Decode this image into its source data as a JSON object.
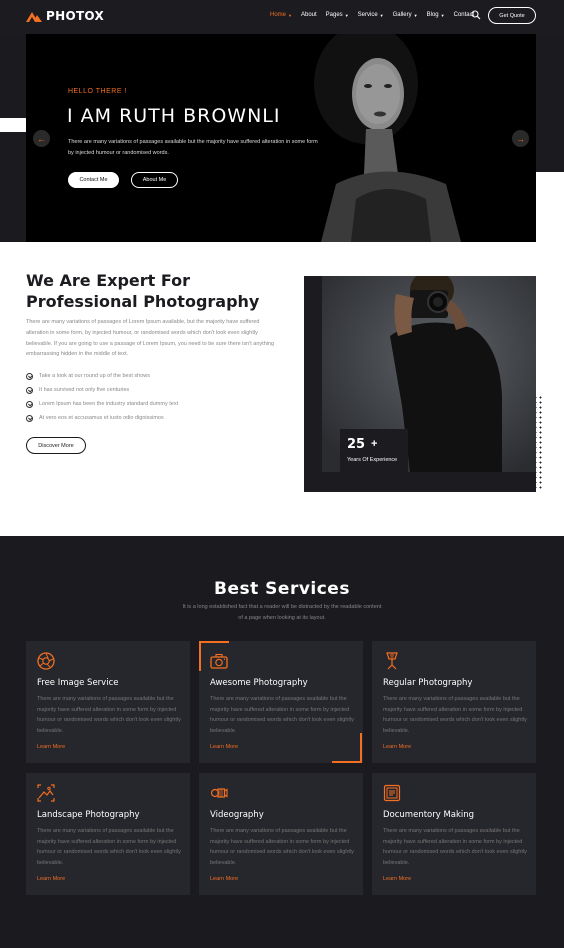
{
  "header": {
    "logo_text": "PHOTOX",
    "nav": [
      {
        "label": "Home",
        "caret": true,
        "active": true
      },
      {
        "label": "About",
        "caret": false,
        "active": false
      },
      {
        "label": "Pages",
        "caret": true,
        "active": false
      },
      {
        "label": "Service",
        "caret": true,
        "active": false
      },
      {
        "label": "Gallery",
        "caret": true,
        "active": false
      },
      {
        "label": "Blog",
        "caret": true,
        "active": false
      },
      {
        "label": "Contact",
        "caret": false,
        "active": false
      }
    ],
    "quote_button": "Get Quote"
  },
  "hero": {
    "greeting": "HELLO THERE !",
    "title": "I AM RUTH BROWNLI",
    "description": "There are many variations of passages available but the majority have suffered alteration in some form by injected humour or randomised words.",
    "contact_button": "Contact Me",
    "about_button": "About Me",
    "prev_arrow": "←",
    "next_arrow": "→"
  },
  "about": {
    "title": "We Are Expert For Professional Photography",
    "description": "There are many variations of passages of Lorem Ipsum available, but the majority have suffered alteration in some form, by injected humour, or randomised words which don't look even slightly believable. If you are going to use a passage of Lorem Ipsum, you need to be sure there isn't anything embarrassing hidden in the middle of text.",
    "checklist": [
      "Take a look at our round up of the best shows",
      "It has survived not only five centuries",
      "Lorem Ipsum has been the industry standard dummy text",
      "At vero eos et accusamus et iusto odio dignissimos"
    ],
    "button": "Discover More",
    "experience_number": "25",
    "experience_plus": "+",
    "experience_label": "Years Of Experience"
  },
  "services": {
    "title": "Best Services",
    "subtitle": "It is a long established fact that a reader will be distracted by the readable content of a page when looking at its layout.",
    "cards": [
      {
        "icon": "aperture-icon",
        "title": "Free Image Service",
        "description": "There are many variations of passages available but the majority have suffered alteration in some form by injected humour or randomised words which don't look even slightly believable.",
        "link": "Learn More"
      },
      {
        "icon": "camera-icon",
        "title": "Awesome Photography",
        "description": "There are many variations of passages available but the majority have suffered alteration in some form by injected humour or randomised words which don't look even slightly believable.",
        "link": "Learn More"
      },
      {
        "icon": "light-stand-icon",
        "title": "Regular Photography",
        "description": "There are many variations of passages available but the majority have suffered alteration in some form by injected humour or randomised words which don't look even slightly believable.",
        "link": "Learn More"
      },
      {
        "icon": "landscape-icon",
        "title": "Landscape Photography",
        "description": "There are many variations of passages available but the majority have suffered alteration in some form by injected humour or randomised words which don't look even slightly believable.",
        "link": "Learn More"
      },
      {
        "icon": "video-camera-icon",
        "title": "Videography",
        "description": "There are many variations of passages available but the majority have suffered alteration in some form by injected humour or randomised words which don't look even slightly believable.",
        "link": "Learn More"
      },
      {
        "icon": "film-icon",
        "title": "Documentory Making",
        "description": "There are many variations of passages available but the majority have suffered alteration in some form by injected humour or randomised words which don't look even slightly believable.",
        "link": "Learn More"
      }
    ]
  },
  "colors": {
    "accent": "#f36f21",
    "dark": "#1b1b20",
    "card": "#26262d"
  }
}
